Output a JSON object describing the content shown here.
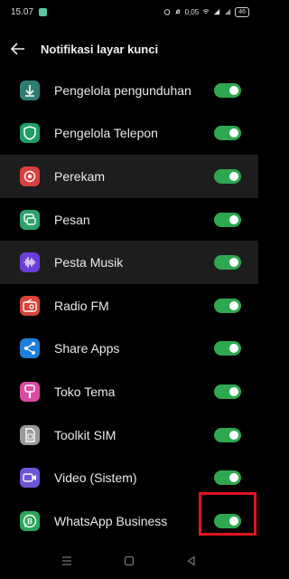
{
  "status_bar": {
    "time": "15.07",
    "net_speed": "0,05",
    "battery": "46"
  },
  "header": {
    "title": "Notifikasi layar kunci"
  },
  "apps": [
    {
      "label": "Pengelola pengunduhan",
      "icon": "download-icon",
      "color": "#2f7d72",
      "enabled": true,
      "highlight": false
    },
    {
      "label": "Pengelola Telepon",
      "icon": "shield-icon",
      "color": "#1f9e68",
      "enabled": true,
      "highlight": false
    },
    {
      "label": "Perekam",
      "icon": "record-icon",
      "color": "#d9403d",
      "enabled": true,
      "highlight": true
    },
    {
      "label": "Pesan",
      "icon": "message-icon",
      "color": "#2ea16c",
      "enabled": true,
      "highlight": false
    },
    {
      "label": "Pesta Musik",
      "icon": "music-wave-icon",
      "color": "#6b3fd6",
      "enabled": true,
      "highlight": true
    },
    {
      "label": "Radio FM",
      "icon": "radio-icon",
      "color": "#d8453c",
      "enabled": true,
      "highlight": false
    },
    {
      "label": "Share Apps",
      "icon": "share-icon",
      "color": "#1e7ed8",
      "enabled": true,
      "highlight": false
    },
    {
      "label": "Toko Tema",
      "icon": "brush-icon",
      "color": "#d84ba0",
      "enabled": true,
      "highlight": false
    },
    {
      "label": "Toolkit SIM",
      "icon": "sim-icon",
      "color": "#9a9a9a",
      "enabled": true,
      "highlight": false
    },
    {
      "label": "Video (Sistem)",
      "icon": "video-icon",
      "color": "#6e55d8",
      "enabled": true,
      "highlight": false
    },
    {
      "label": "WhatsApp Business",
      "icon": "whatsapp-business-icon",
      "color": "#2aa55a",
      "enabled": true,
      "highlight": false
    }
  ],
  "colors": {
    "toggle_on": "#2ea84f",
    "annotation": "#e0141e"
  }
}
